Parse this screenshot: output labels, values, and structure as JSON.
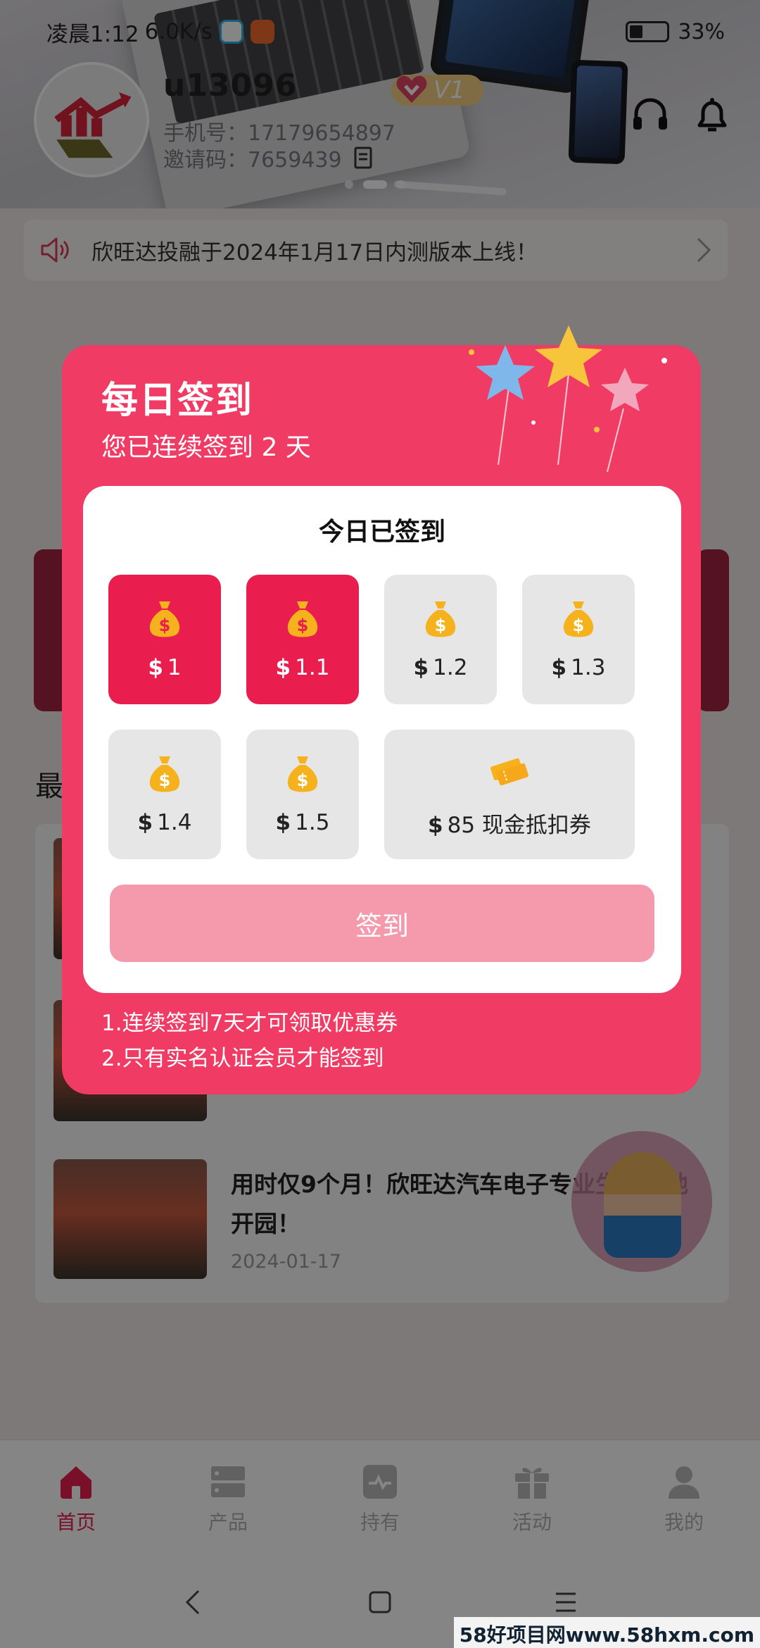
{
  "status": {
    "time": "凌晨1:12",
    "net": "6.0K/s",
    "battery": "33%"
  },
  "user": {
    "username": "u13096",
    "vip": "V1",
    "phone_label": "手机号：17179654897",
    "invite_label": "邀请码：7659439"
  },
  "notice": {
    "text": "欣旺达投融于2024年1月17日内测版本上线！"
  },
  "section_title": "最",
  "news": {
    "last_title": "用时仅9个月！欣旺达汽车电子专业生产基地开园！",
    "last_date": "2024-01-17"
  },
  "checkin": {
    "title": "每日签到",
    "subtitle": "您已连续签到 2 天",
    "card_title": "今日已签到",
    "currency": "$",
    "tiles": [
      {
        "amount": "1",
        "state": "done"
      },
      {
        "amount": "1.1",
        "state": "done"
      },
      {
        "amount": "1.2",
        "state": "pending"
      },
      {
        "amount": "1.3",
        "state": "pending"
      },
      {
        "amount": "1.4",
        "state": "pending"
      },
      {
        "amount": "1.5",
        "state": "pending"
      },
      {
        "amount": "85 现金抵扣券",
        "state": "pending"
      }
    ],
    "button": "签到",
    "rules": [
      "1.连续签到7天才可领取优惠券",
      "2.只有实名认证会员才能签到"
    ]
  },
  "tabs": [
    {
      "label": "首页",
      "icon": "home-icon",
      "active": true
    },
    {
      "label": "产品",
      "icon": "products-icon",
      "active": false
    },
    {
      "label": "持有",
      "icon": "holdings-icon",
      "active": false
    },
    {
      "label": "活动",
      "icon": "gift-icon",
      "active": false
    },
    {
      "label": "我的",
      "icon": "profile-icon",
      "active": false
    }
  ],
  "watermark": "58好项目网www.58hxm.com",
  "colors": {
    "accent": "#e91e4e",
    "modal": "#f03c65",
    "button": "#f59aac",
    "coin": "#f6b21c"
  }
}
